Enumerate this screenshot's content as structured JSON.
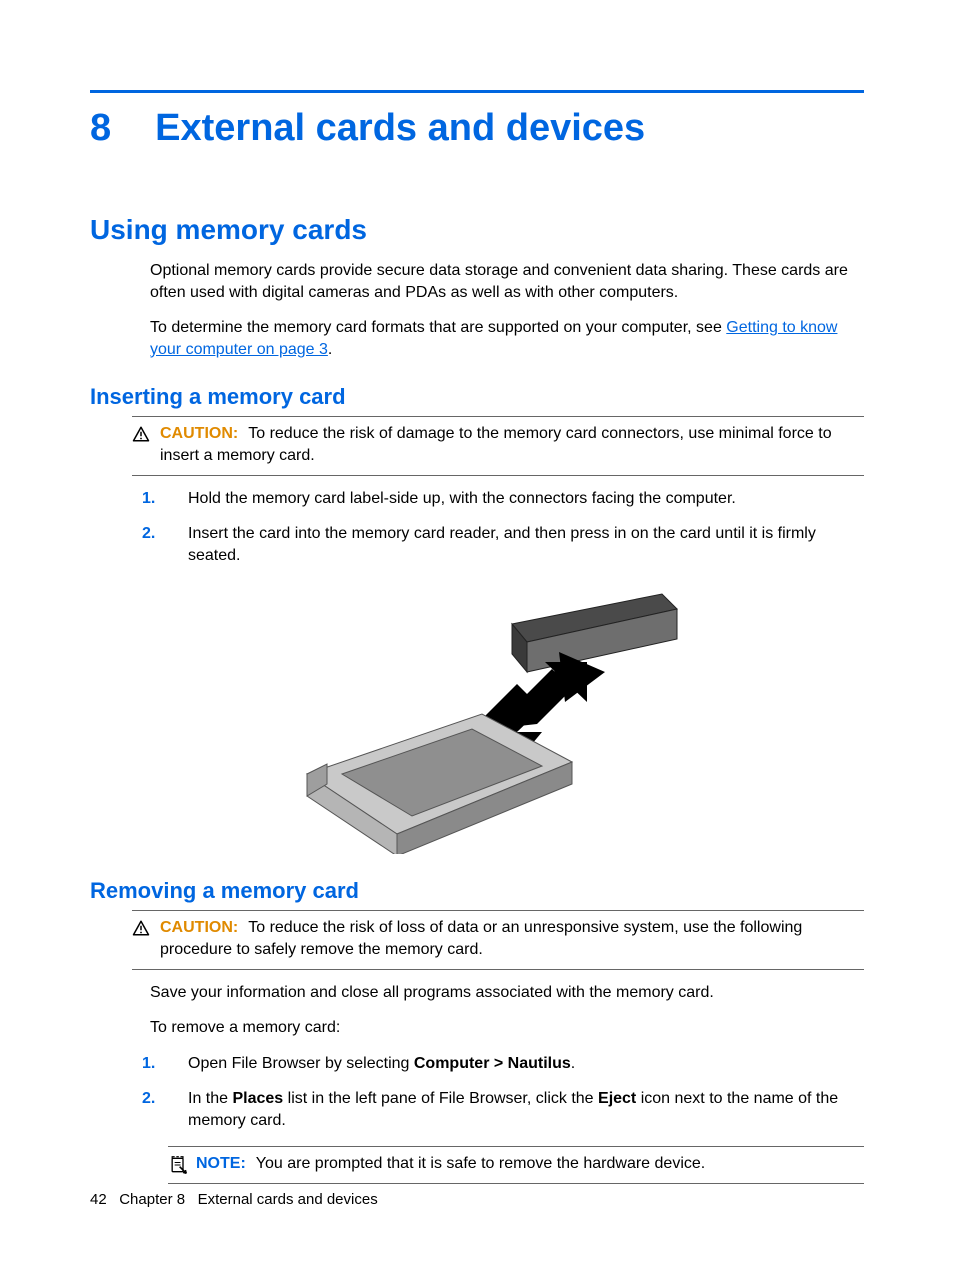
{
  "chapter": {
    "number": "8",
    "title": "External cards and devices"
  },
  "section1": {
    "title": "Using memory cards",
    "para1": "Optional memory cards provide secure data storage and convenient data sharing. These cards are often used with digital cameras and PDAs as well as with other computers.",
    "para2_pre": "To determine the memory card formats that are supported on your computer, see ",
    "para2_link": "Getting to know your computer on page 3",
    "para2_post": "."
  },
  "insert": {
    "title": "Inserting a memory card",
    "caution_label": "CAUTION:",
    "caution_text": "To reduce the risk of damage to the memory card connectors, use minimal force to insert a memory card.",
    "steps": [
      {
        "n": "1.",
        "text": "Hold the memory card label-side up, with the connectors facing the computer."
      },
      {
        "n": "2.",
        "text": "Insert the card into the memory card reader, and then press in on the card until it is firmly seated."
      }
    ]
  },
  "remove": {
    "title": "Removing a memory card",
    "caution_label": "CAUTION:",
    "caution_text": "To reduce the risk of loss of data or an unresponsive system, use the following procedure to safely remove the memory card.",
    "para1": "Save your information and close all programs associated with the memory card.",
    "para2": "To remove a memory card:",
    "step1_n": "1.",
    "step1_pre": "Open File Browser by selecting ",
    "step1_bold": "Computer > Nautilus",
    "step1_post": ".",
    "step2_n": "2.",
    "step2_pre": "In the ",
    "step2_b1": "Places",
    "step2_mid": " list in the left pane of File Browser, click the ",
    "step2_b2": "Eject",
    "step2_post": " icon next to the name of the memory card.",
    "note_label": "NOTE:",
    "note_text": "You are prompted that it is safe to remove the hardware device."
  },
  "footer": {
    "page": "42",
    "chapter_label": "Chapter 8",
    "chapter_title": "External cards and devices"
  }
}
